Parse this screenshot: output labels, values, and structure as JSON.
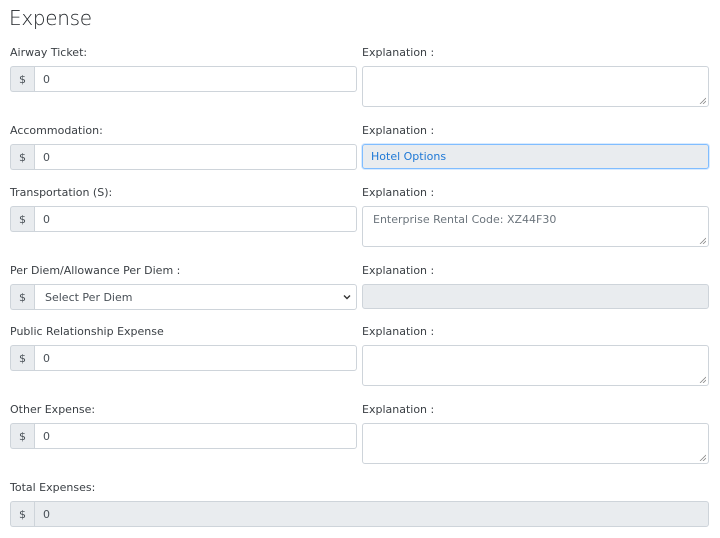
{
  "page": {
    "title": "Expense"
  },
  "explanation_label": "Explanation :",
  "currency_symbol": "$",
  "rows": {
    "airway": {
      "label": "Airway Ticket:",
      "value": "0"
    },
    "accommodation": {
      "label": "Accommodation:",
      "value": "0",
      "explanation": "Hotel Options"
    },
    "transportation": {
      "label": "Transportation (S):",
      "value": "0",
      "explanation_placeholder": "Enterprise Rental Code: XZ44F30"
    },
    "per_diem": {
      "label": "Per Diem/Allowance Per Diem :",
      "selected": "Select Per Diem"
    },
    "public_relationship": {
      "label": "Public Relationship Expense",
      "value": "0"
    },
    "other": {
      "label": "Other Expense:",
      "value": "0"
    },
    "total": {
      "label": "Total Expenses:",
      "value": "0"
    }
  }
}
